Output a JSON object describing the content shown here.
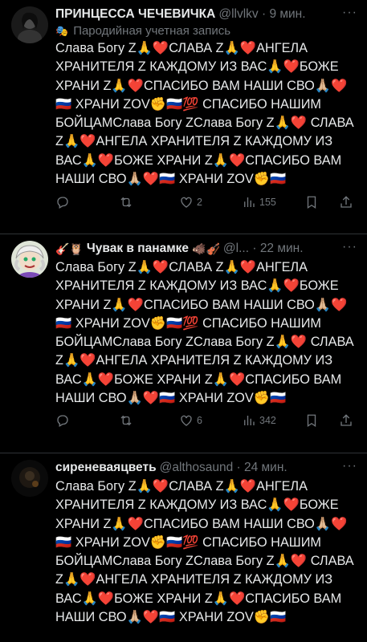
{
  "tweets": [
    {
      "display_name": "ПРИНЦЕССА ЧЕЧЕВИЧКА",
      "handle": "@llvlkv",
      "time": "9 мин.",
      "parody_label": "Пародийная учетная запись",
      "text": "Слава Богу Z🙏❤️СЛАВА Z🙏❤️АНГЕЛА ХРАНИТЕЛЯ Z КАЖДОМУ ИЗ ВАС🙏❤️БОЖЕ ХРАНИ Z🙏❤️СПАСИБО ВАМ НАШИ СВО🙏🏼❤️🇷🇺 ХРАНИ ZOV✊🇷🇺💯 СПАСИБО НАШИМ БОЙЦАМСлава Богу ZСлава Богу Z🙏❤️ СЛАВА Z🙏❤️АНГЕЛА ХРАНИТЕЛЯ Z КАЖДОМУ ИЗ ВАС🙏❤️БОЖЕ ХРАНИ Z🙏❤️СПАСИБО ВАМ НАШИ СВО🙏🏼❤️🇷🇺 ХРАНИ ZOV✊🇷🇺",
      "replies": "",
      "retweets": "",
      "likes": "2",
      "views": "155"
    },
    {
      "display_name": "Чувак в панамке",
      "handle_prefix_emoji": "🎸🦉",
      "name_suffix_emoji": "🐗🎻",
      "handle": "@l...",
      "time": "22 мин.",
      "text": "Слава Богу Z🙏❤️СЛАВА Z🙏❤️АНГЕЛА ХРАНИТЕЛЯ Z КАЖДОМУ ИЗ ВАС🙏❤️БОЖЕ ХРАНИ Z🙏❤️СПАСИБО ВАМ НАШИ СВО🙏🏼❤️🇷🇺 ХРАНИ ZOV✊🇷🇺💯 СПАСИБО НАШИМ БОЙЦАМСлава Богу ZСлава Богу Z🙏❤️ СЛАВА Z🙏❤️АНГЕЛА ХРАНИТЕЛЯ Z КАЖДОМУ ИЗ ВАС🙏❤️БОЖЕ ХРАНИ Z🙏❤️СПАСИБО ВАМ НАШИ СВО🙏🏼❤️🇷🇺 ХРАНИ ZOV✊🇷🇺",
      "replies": "",
      "retweets": "",
      "likes": "6",
      "views": "342"
    },
    {
      "display_name": "сиреневаяцветь",
      "handle": "@althosaund",
      "time": "24 мин.",
      "text": "Слава Богу Z🙏❤️СЛАВА Z🙏❤️АНГЕЛА ХРАНИТЕЛЯ Z КАЖДОМУ ИЗ ВАС🙏❤️БОЖЕ ХРАНИ Z🙏❤️СПАСИБО ВАМ НАШИ СВО🙏🏼❤️🇷🇺 ХРАНИ ZOV✊🇷🇺💯 СПАСИБО НАШИМ БОЙЦАМСлава Богу ZСлава Богу Z🙏❤️ СЛАВА Z🙏❤️АНГЕЛА ХРАНИТЕЛЯ Z КАЖДОМУ ИЗ ВАС🙏❤️БОЖЕ ХРАНИ Z🙏❤️СПАСИБО ВАМ НАШИ СВО🙏🏼❤️🇷🇺 ХРАНИ ZOV✊🇷🇺"
    }
  ],
  "colors": {
    "background": "#000000",
    "text": "#e7e9ea",
    "secondary": "#71767b",
    "divider": "#2f3336"
  },
  "icons": [
    "reply-icon",
    "retweet-icon",
    "like-icon",
    "views-icon",
    "bookmark-icon",
    "share-icon",
    "more-icon",
    "parody-mask-icon"
  ]
}
